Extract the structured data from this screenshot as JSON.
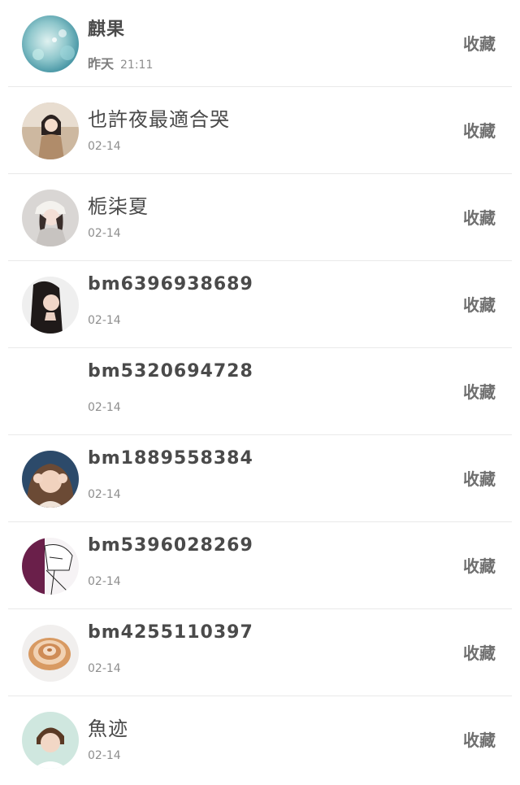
{
  "items": [
    {
      "name": "麒果",
      "date_day": "昨天",
      "date_time": "21:11",
      "action": "收藏",
      "avatar": "blue-bokeh"
    },
    {
      "name": "也許夜最適合哭",
      "date": "02-14",
      "action": "收藏",
      "avatar": "girl-coat"
    },
    {
      "name": "栀柒夏",
      "date": "02-14",
      "action": "收藏",
      "avatar": "girl-cap"
    },
    {
      "name": "bm6396938689",
      "date": "02-14",
      "action": "收藏",
      "avatar": "girl-dark-hair"
    },
    {
      "name": "bm5320694728",
      "date": "02-14",
      "action": "收藏",
      "avatar": "none"
    },
    {
      "name": "bm1889558384",
      "date": "02-14",
      "action": "收藏",
      "avatar": "girl-hands"
    },
    {
      "name": "bm5396028269",
      "date": "02-14",
      "action": "收藏",
      "avatar": "anime-sketch"
    },
    {
      "name": "bm4255110397",
      "date": "02-14",
      "action": "收藏",
      "avatar": "seashell"
    },
    {
      "name": "魚迹",
      "date": "02-14",
      "action": "收藏",
      "avatar": "boy-portrait"
    }
  ]
}
